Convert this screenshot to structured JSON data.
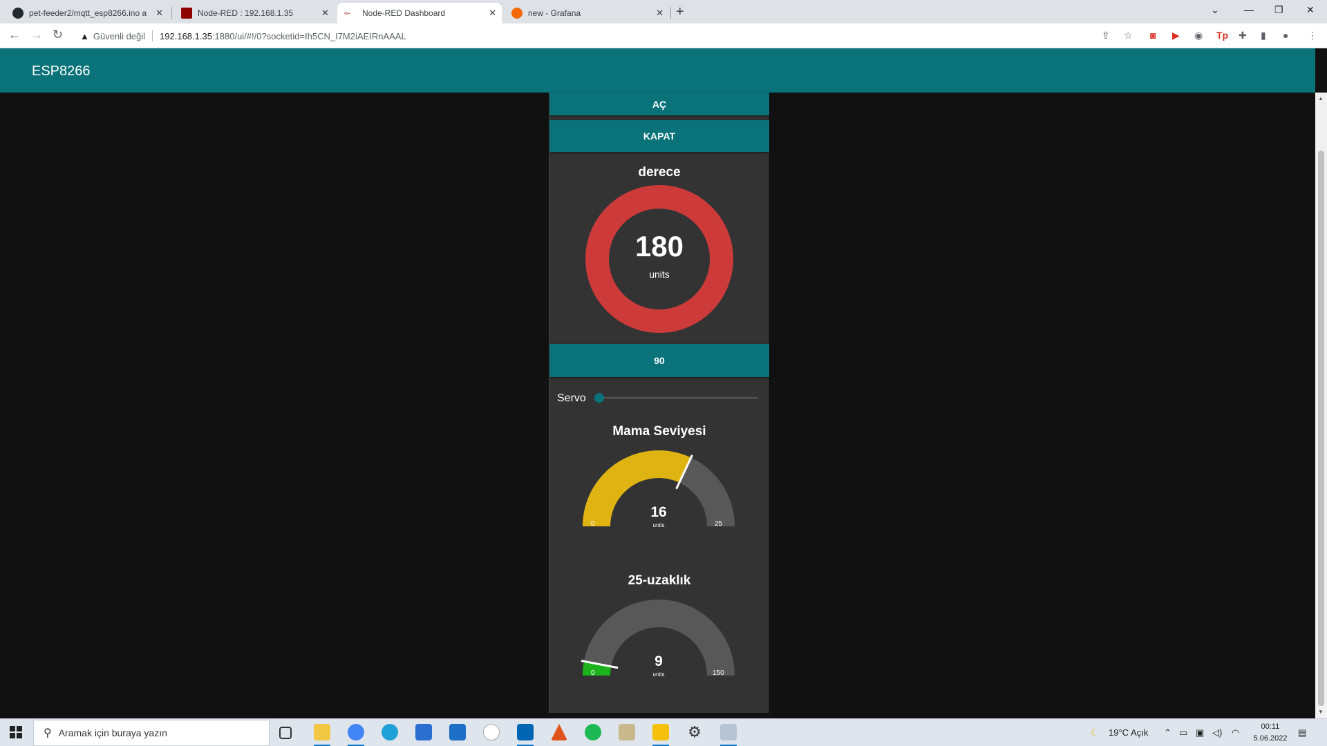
{
  "browser": {
    "tabs": [
      {
        "title": "pet-feeder2/mqtt_esp8266.ino at",
        "icon": "github-icon"
      },
      {
        "title": "Node-RED : 192.168.1.35",
        "icon": "node-red-icon"
      },
      {
        "title": "Node-RED Dashboard",
        "icon": "node-red-dashboard-icon"
      },
      {
        "title": "new - Grafana",
        "icon": "grafana-icon"
      }
    ],
    "security_label": "Güvenli değil",
    "url_host": "192.168.1.35",
    "url_rest": ":1880/ui/#!/0?socketid=Ih5CN_I7M2iAEIRnAAAL"
  },
  "dashboard": {
    "title": "ESP8266",
    "buttons": {
      "open": "AÇ",
      "close": "KAPAT",
      "ninety": "90"
    },
    "donut": {
      "title": "derece",
      "value": "180",
      "units": "units",
      "color": "#cc3a3a"
    },
    "slider": {
      "label": "Servo",
      "value": 0
    },
    "gauge1": {
      "title": "Mama Seviyesi",
      "value": "16",
      "units": "units",
      "min": "0",
      "max": "25",
      "fraction": 0.64,
      "color": "#dfb311"
    },
    "gauge2": {
      "title": "25-uzaklık",
      "value": "9",
      "units": "units",
      "min": "0",
      "max": "150",
      "fraction": 0.06,
      "color": "#1cb31c"
    }
  },
  "taskbar": {
    "search_placeholder": "Aramak için buraya yazın",
    "weather": "19°C  Açık",
    "time": "00:11",
    "date": "5.06.2022"
  }
}
